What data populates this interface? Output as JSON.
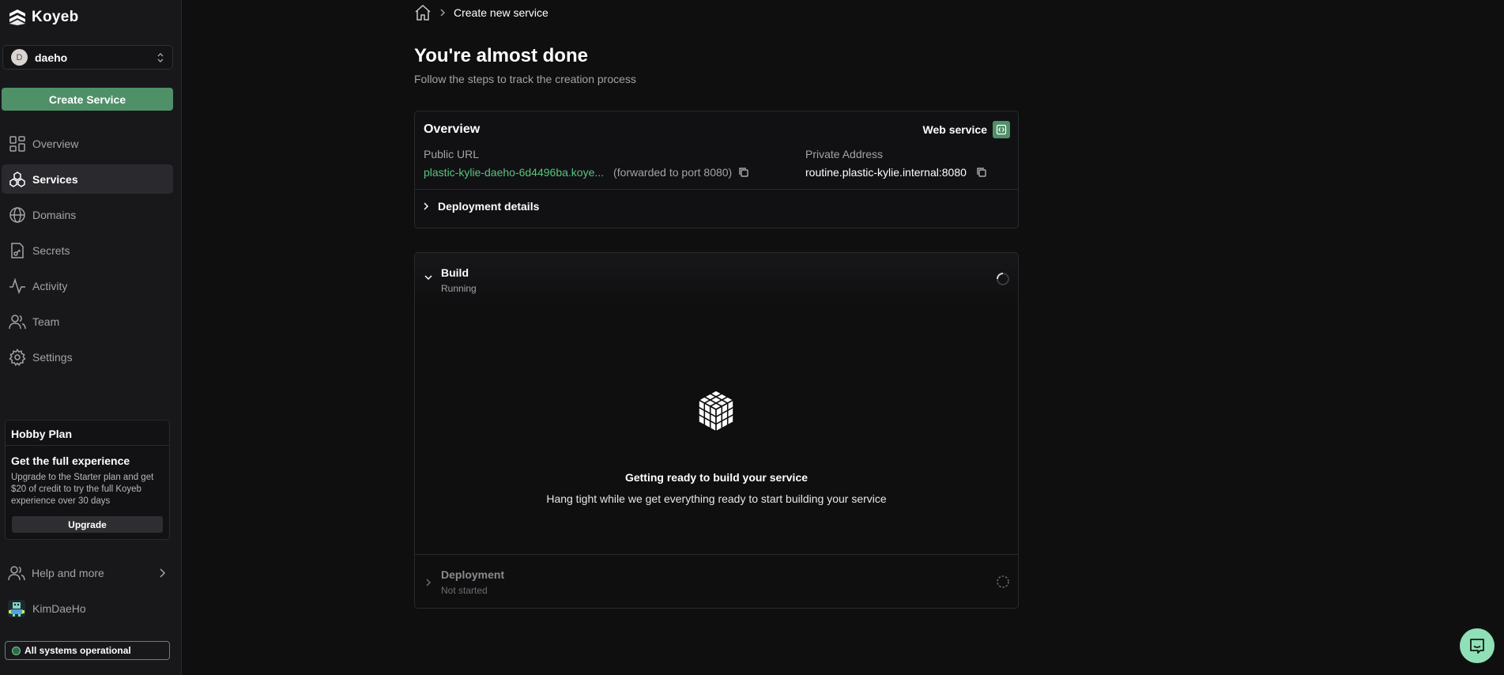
{
  "brand": {
    "name": "Koyeb"
  },
  "org": {
    "initial": "D",
    "name": "daeho"
  },
  "sidebar": {
    "create_label": "Create Service",
    "items": [
      {
        "label": "Overview",
        "icon": "dashboard-icon"
      },
      {
        "label": "Services",
        "icon": "services-icon",
        "active": true
      },
      {
        "label": "Domains",
        "icon": "globe-icon"
      },
      {
        "label": "Secrets",
        "icon": "secret-file-icon"
      },
      {
        "label": "Activity",
        "icon": "activity-icon"
      },
      {
        "label": "Team",
        "icon": "team-icon"
      },
      {
        "label": "Settings",
        "icon": "gear-icon"
      }
    ],
    "plan": {
      "name": "Hobby Plan",
      "title": "Get the full experience",
      "description": "Upgrade to the Starter plan and get $20 of credit to try the full Koyeb experience over 30 days",
      "upgrade_label": "Upgrade"
    },
    "help_label": "Help and more",
    "user_name": "KimDaeHo",
    "status_text": "All systems operational"
  },
  "breadcrumb": {
    "current": "Create new service"
  },
  "page": {
    "title": "You're almost done",
    "subtitle": "Follow the steps to track the creation process"
  },
  "overview": {
    "title": "Overview",
    "service_type": "Web service",
    "public_url_label": "Public URL",
    "public_url": "plastic-kylie-daeho-6d4496ba.koye...",
    "public_url_note": "(forwarded to port 8080)",
    "private_label": "Private Address",
    "private_address": "routine.plastic-kylie.internal:8080",
    "deployment_details_label": "Deployment details"
  },
  "steps": {
    "build": {
      "title": "Build",
      "status": "Running",
      "empty_title": "Getting ready to build your service",
      "empty_sub": "Hang tight while we get everything ready to start building your service"
    },
    "deployment": {
      "title": "Deployment",
      "status": "Not started"
    }
  },
  "colors": {
    "accent": "#4f9068",
    "link": "#58c47f",
    "chat": "#8fe0b6"
  }
}
